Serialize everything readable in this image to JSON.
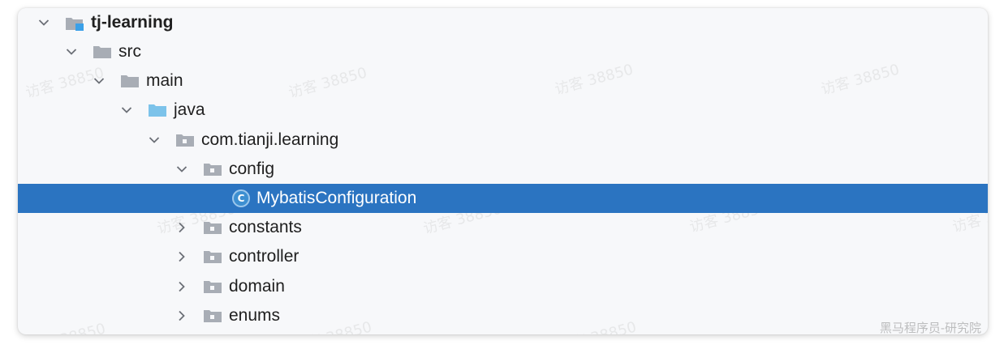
{
  "tree": {
    "nodes": [
      {
        "label": "tj-learning",
        "icon": "module-folder-icon",
        "expanded": true,
        "selected": false
      },
      {
        "label": "src",
        "icon": "folder-icon",
        "expanded": true,
        "selected": false
      },
      {
        "label": "main",
        "icon": "folder-icon",
        "expanded": true,
        "selected": false
      },
      {
        "label": "java",
        "icon": "source-root-folder-icon",
        "expanded": true,
        "selected": false
      },
      {
        "label": "com.tianji.learning",
        "icon": "package-folder-icon",
        "expanded": true,
        "selected": false
      },
      {
        "label": "config",
        "icon": "package-folder-icon",
        "expanded": true,
        "selected": false
      },
      {
        "label": "MybatisConfiguration",
        "icon": "java-class-icon",
        "icon_letter": "C",
        "expanded": null,
        "selected": true
      },
      {
        "label": "constants",
        "icon": "package-folder-icon",
        "expanded": false,
        "selected": false
      },
      {
        "label": "controller",
        "icon": "package-folder-icon",
        "expanded": false,
        "selected": false
      },
      {
        "label": "domain",
        "icon": "package-folder-icon",
        "expanded": false,
        "selected": false
      },
      {
        "label": "enums",
        "icon": "package-folder-icon",
        "expanded": false,
        "selected": false
      }
    ]
  },
  "watermark": {
    "text": "访客 38850",
    "corner_text": "黑马程序员-研究院"
  },
  "colors": {
    "selection": "#2b74c1",
    "folder_gray": "#a8adb5",
    "source_root_blue": "#7cc3ea",
    "module_badge_blue": "#3aa0e8",
    "class_icon_blue": "#3d8fd1"
  }
}
